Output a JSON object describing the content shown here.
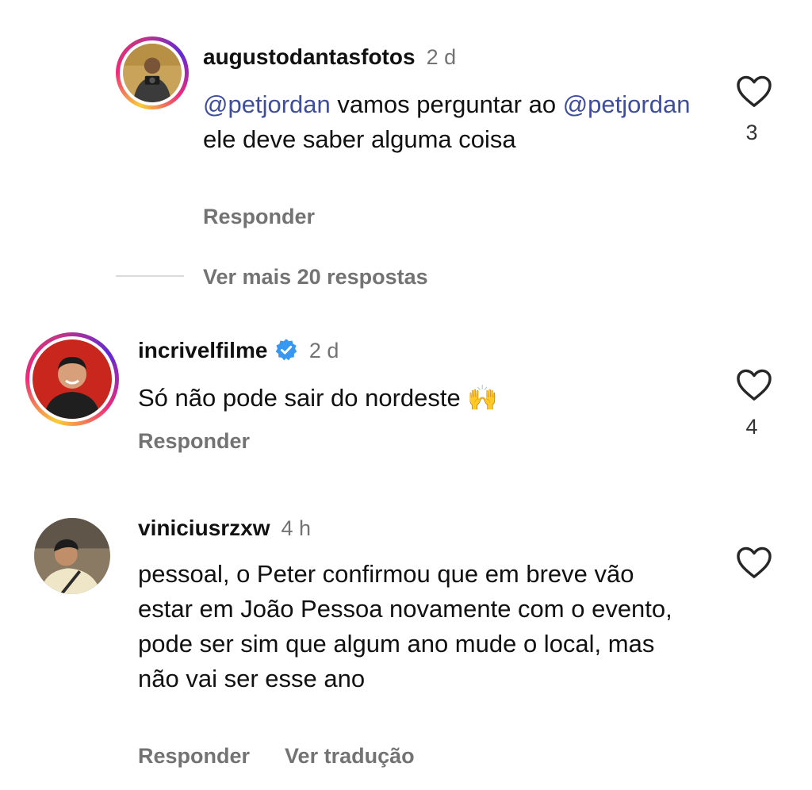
{
  "comments": [
    {
      "username": "augustodantasfotos",
      "time": "2 d",
      "text_parts": [
        {
          "mention": "@petjordan"
        },
        {
          "text": " vamos perguntar ao "
        },
        {
          "mention": "@petjordan"
        },
        {
          "text": " ele deve saber alguma coisa"
        }
      ],
      "reply_label": "Responder",
      "like_count": "3",
      "view_more_label": "Ver mais 20 respostas"
    },
    {
      "username": "incrivelfilme",
      "verified": true,
      "time": "2 d",
      "text": "Só não pode sair do nordeste 🙌",
      "reply_label": "Responder",
      "like_count": "4"
    },
    {
      "username": "viniciusrzxw",
      "time": "4 h",
      "text": "pessoal, o Peter confirmou que em breve vão estar em João Pessoa novamente com o evento, pode ser sim que algum ano mude o local, mas não vai ser esse ano",
      "reply_label": "Responder",
      "translate_label": "Ver tradução",
      "like_count": ""
    }
  ],
  "colors": {
    "mention": "#3e4d9e",
    "verified": "#3897f0",
    "secondary_text": "#737373"
  }
}
